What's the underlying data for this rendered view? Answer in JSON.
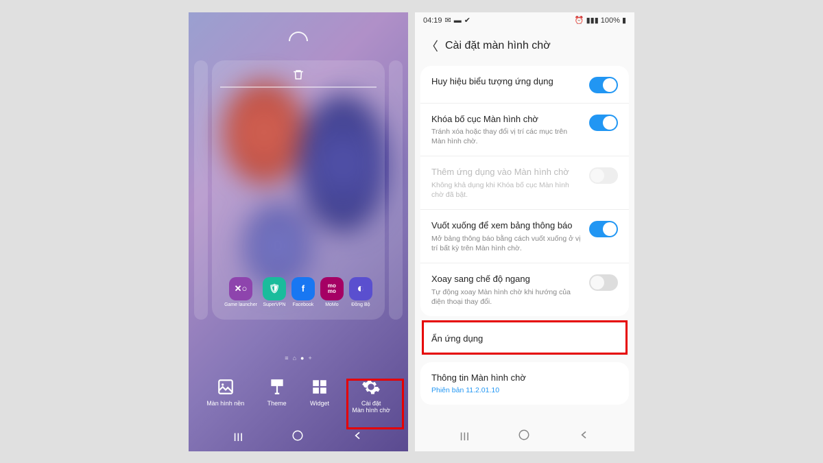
{
  "left": {
    "apps": [
      {
        "label": "Game launcher",
        "icon": "game"
      },
      {
        "label": "SuperVPN",
        "icon": "vpn"
      },
      {
        "label": "Facebook",
        "icon": "fb"
      },
      {
        "label": "MoMo",
        "icon": "momo"
      },
      {
        "label": "Đồng Bộ",
        "icon": "dongbo"
      }
    ],
    "toolbar": [
      {
        "label": "Màn hình nền",
        "icon": "wallpaper"
      },
      {
        "label": "Theme",
        "icon": "theme"
      },
      {
        "label": "Widget",
        "icon": "widget"
      },
      {
        "label": "Cài đặt\nMàn hình chờ",
        "icon": "settings"
      }
    ]
  },
  "right": {
    "status": {
      "time": "04:19",
      "battery": "100%"
    },
    "title": "Cài đặt màn hình chờ",
    "rows": [
      {
        "title": "Huy hiệu biểu tượng ứng dụng",
        "toggle": "on"
      },
      {
        "title": "Khóa bố cục Màn hình chờ",
        "sub": "Tránh xóa hoặc thay đổi vị trí các mục trên Màn hình chờ.",
        "toggle": "on"
      },
      {
        "title": "Thêm ứng dụng vào Màn hình chờ",
        "sub": "Không khả dụng khi Khóa bố cục Màn hình chờ đã bật.",
        "toggle": "dis",
        "disabled": true
      },
      {
        "title": "Vuốt xuống để xem bảng thông báo",
        "sub": "Mở bảng thông báo bằng cách vuốt xuống ở vị trí bất kỳ trên Màn hình chờ.",
        "toggle": "on"
      },
      {
        "title": "Xoay sang chế độ ngang",
        "sub": "Tự động xoay Màn hình chờ khi hướng của điện thoại thay đổi.",
        "toggle": "off"
      }
    ],
    "hide_apps": "Ẩn ứng dụng",
    "info": {
      "title": "Thông tin Màn hình chờ",
      "sub": "Phiên bản 11.2.01.10"
    }
  }
}
